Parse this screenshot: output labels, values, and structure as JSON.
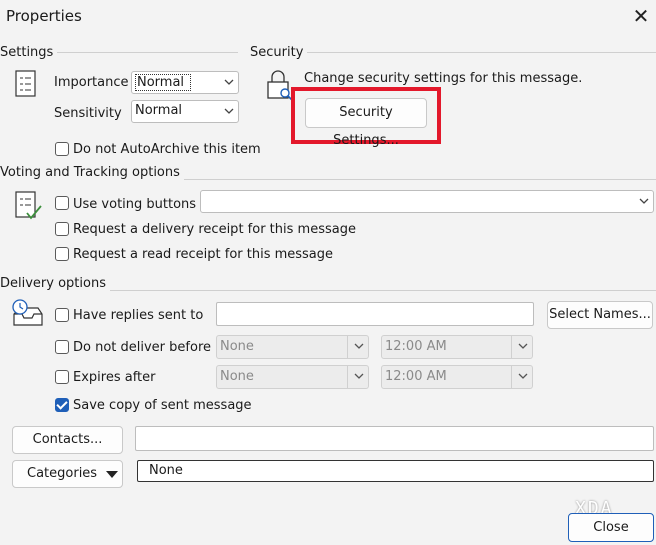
{
  "window": {
    "title": "Properties",
    "close_icon": "close-icon"
  },
  "settings": {
    "group_label": "Settings",
    "importance_label": "Importance",
    "importance_value": "Normal",
    "sensitivity_label": "Sensitivity",
    "sensitivity_value": "Normal",
    "autoarchive_label": "Do not AutoArchive this item",
    "autoarchive_checked": false
  },
  "security": {
    "group_label": "Security",
    "description": "Change security settings for this message.",
    "button_label": "Security Settings...",
    "highlight_color": "#e3182b"
  },
  "voting": {
    "group_label": "Voting and Tracking options",
    "use_voting_label": "Use voting buttons",
    "voting_value": "",
    "delivery_receipt_label": "Request a delivery receipt for this message",
    "read_receipt_label": "Request a read receipt for this message"
  },
  "delivery": {
    "group_label": "Delivery options",
    "replies_label": "Have replies sent to",
    "replies_value": "",
    "select_names_label": "Select Names...",
    "do_not_deliver_label": "Do not deliver before",
    "do_not_deliver_date": "None",
    "do_not_deliver_time": "12:00 AM",
    "expires_label": "Expires after",
    "expires_date": "None",
    "expires_time": "12:00 AM",
    "save_copy_label": "Save copy of sent message",
    "save_copy_checked": true,
    "contacts_label": "Contacts...",
    "contacts_value": "",
    "categories_label": "Categories",
    "categories_value": "None"
  },
  "footer": {
    "close_label": "Close",
    "watermark": "XDA"
  },
  "colors": {
    "accent": "#1f5fb8",
    "highlight": "#e3182b",
    "background": "#f3f3f3"
  }
}
